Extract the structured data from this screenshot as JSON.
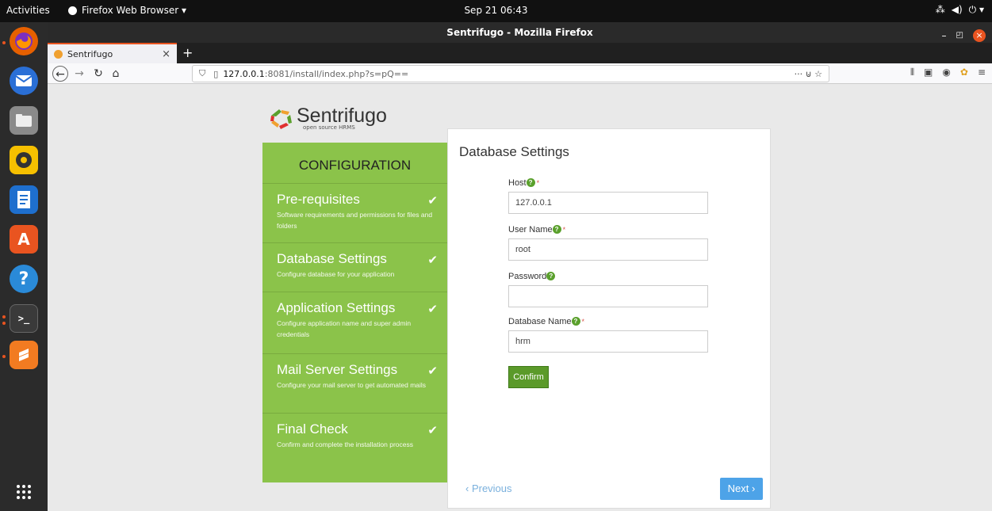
{
  "system": {
    "activities": "Activities",
    "app_menu": "Firefox Web Browser ▾",
    "clock": "Sep 21  06:43",
    "tray": [
      "⁂",
      "◀)",
      "⏻ ▾"
    ]
  },
  "dock": {
    "apps": [
      {
        "icon": "firefox-icon",
        "color": "#e66000"
      },
      {
        "icon": "thunderbird-icon",
        "color": "#2a6fd6"
      },
      {
        "icon": "files-icon",
        "color": "#8a8a8a"
      },
      {
        "icon": "rhythmbox-icon",
        "color": "#f6c000"
      },
      {
        "icon": "writer-icon",
        "color": "#1e6fce"
      },
      {
        "icon": "software-icon",
        "color": "#e95420"
      },
      {
        "icon": "help-icon",
        "color": "#2a8ad8"
      },
      {
        "icon": "terminal-icon",
        "color": "#3a3a3a"
      },
      {
        "icon": "sublime-icon",
        "color": "#f27b21"
      }
    ],
    "grid_icon": "app-grid-icon"
  },
  "browser": {
    "window_title": "Sentrifugo - Mozilla Firefox",
    "tab_title": "Sentrifugo",
    "tab_close": "×",
    "new_tab": "+",
    "url_host": "127.0.0.1",
    "url_rest": ":8081/install/index.php?s=pQ==",
    "url_actions": "··· ⊍ ☆"
  },
  "logo": {
    "name": "Sentrifugo",
    "tagline": "open source HRMS"
  },
  "config": {
    "heading": "CONFIGURATION",
    "steps": [
      {
        "title": "Pre-requisites",
        "desc": "Software requirements and permissions for files and folders",
        "done": true
      },
      {
        "title": "Database Settings",
        "desc": "Configure database for your application",
        "done": true
      },
      {
        "title": "Application Settings",
        "desc": "Configure application name and super admin credentials",
        "done": true
      },
      {
        "title": "Mail Server Settings",
        "desc": "Configure your mail server to get automated mails",
        "done": true
      },
      {
        "title": "Final Check",
        "desc": "Confirm and complete the installation process",
        "done": true
      }
    ]
  },
  "form": {
    "title": "Database Settings",
    "host": {
      "label": "Host",
      "value": "127.0.0.1",
      "required": "*"
    },
    "user": {
      "label": "User Name",
      "value": "root",
      "required": "*"
    },
    "password": {
      "label": "Password",
      "value": ""
    },
    "dbname": {
      "label": "Database Name",
      "value": "hrm",
      "required": "*"
    },
    "confirm": "Confirm",
    "previous": "‹ Previous",
    "next": "Next ›"
  },
  "colors": {
    "accent": "#8bc34a",
    "confirm": "#5b9a2a",
    "next": "#4da3e8",
    "ubuntu": "#e95420"
  }
}
